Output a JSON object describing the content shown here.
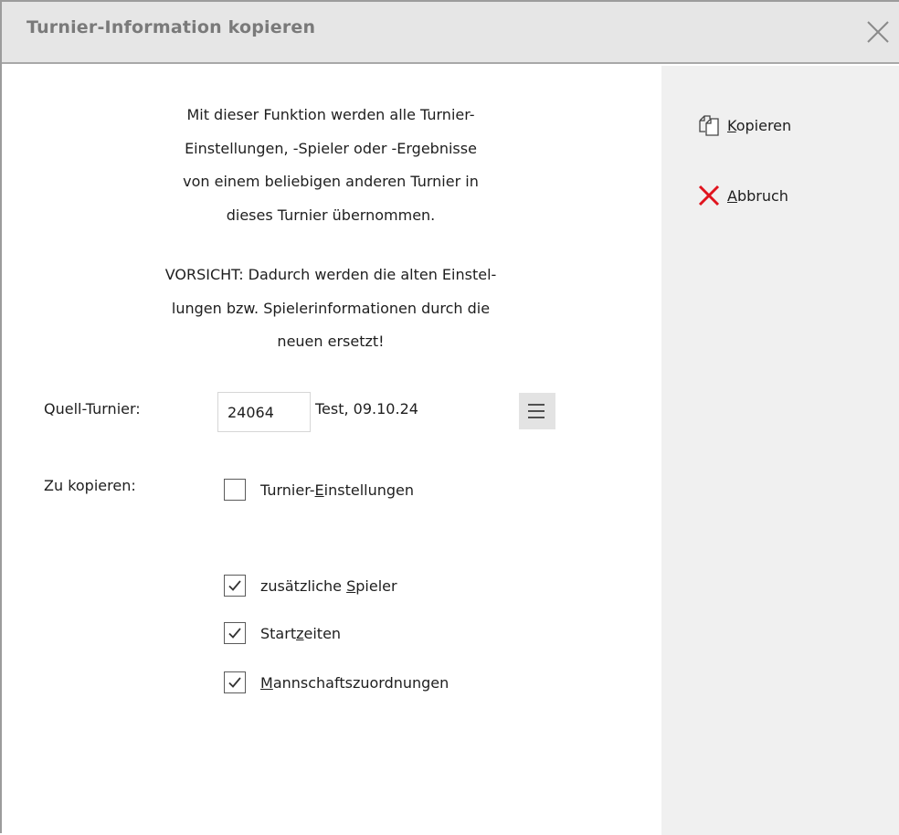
{
  "window": {
    "title": "Turnier-Information kopieren"
  },
  "intro": {
    "lines": [
      "Mit dieser Funktion werden alle Turnier-",
      "Einstellungen, -Spieler oder -Ergebnisse",
      "von einem beliebigen anderen Turnier in",
      "dieses Turnier übernommen."
    ]
  },
  "warning": {
    "lines": [
      "VORSICHT: Dadurch werden die alten Einstel-",
      "lungen bzw. Spielerinformationen durch die",
      "neuen ersetzt!"
    ]
  },
  "source": {
    "label": "Quell-Turnier:",
    "id_value": "24064",
    "name": "Test, 09.10.24",
    "menu_icon": "hamburger-menu-icon"
  },
  "copy": {
    "label": "Zu kopieren:",
    "options": [
      {
        "pre": "Turnier-",
        "key": "E",
        "post": "instellungen",
        "checked": false
      },
      {
        "pre": "zusätzliche ",
        "key": "S",
        "post": "pieler",
        "checked": true
      },
      {
        "pre": "Start",
        "key": "z",
        "post": "eiten",
        "checked": true
      },
      {
        "pre": "",
        "key": "M",
        "post": "annschaftszuordnungen",
        "checked": true
      }
    ]
  },
  "actions": {
    "copy": {
      "key": "K",
      "rest": "opieren",
      "icon": "copy-icon"
    },
    "cancel": {
      "key": "A",
      "rest": "bbruch",
      "icon": "cancel-x-icon",
      "color": "#e0141e"
    }
  },
  "colors": {
    "title": "#7a7a7a",
    "sidebar_bg": "#f0f0f0",
    "titlebar_bg": "#e6e6e6"
  }
}
